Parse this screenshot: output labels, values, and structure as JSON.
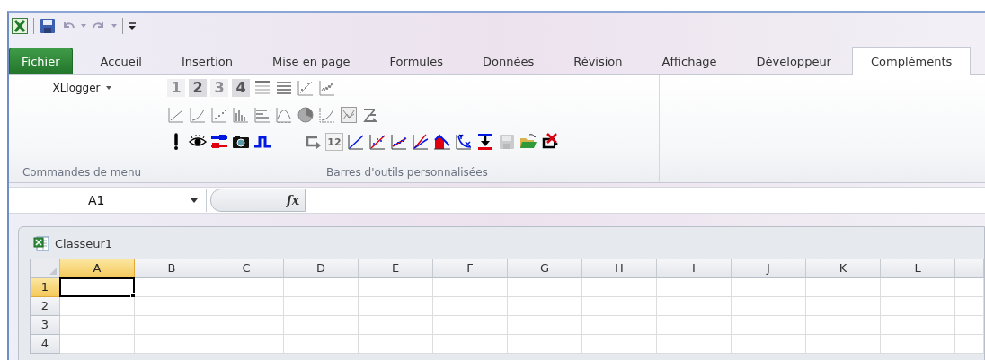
{
  "tabs": [
    {
      "label": "Fichier",
      "kind": "file",
      "selected": false
    },
    {
      "label": "Accueil",
      "kind": "tab",
      "selected": false
    },
    {
      "label": "Insertion",
      "kind": "tab",
      "selected": false
    },
    {
      "label": "Mise en page",
      "kind": "tab",
      "selected": false
    },
    {
      "label": "Formules",
      "kind": "tab",
      "selected": false
    },
    {
      "label": "Données",
      "kind": "tab",
      "selected": false
    },
    {
      "label": "Révision",
      "kind": "tab",
      "selected": false
    },
    {
      "label": "Affichage",
      "kind": "tab",
      "selected": false
    },
    {
      "label": "Développeur",
      "kind": "tab",
      "selected": false
    },
    {
      "label": "Compléments",
      "kind": "tab",
      "selected": true
    }
  ],
  "ribbon": {
    "menu_group": {
      "menu": "XLlogger",
      "label": "Commandes de menu"
    },
    "toolbar_group": {
      "label": "Barres d'outils personnalisées",
      "rows": [
        [
          {
            "kind": "number",
            "label": "1",
            "disabled": true
          },
          {
            "kind": "number",
            "label": "2",
            "disabled": false
          },
          {
            "kind": "number",
            "label": "3",
            "disabled": true
          },
          {
            "kind": "number",
            "label": "4",
            "disabled": false
          },
          {
            "kind": "thin-lines"
          },
          {
            "kind": "thick-lines"
          },
          {
            "kind": "scatter-trend"
          },
          {
            "kind": "noisy-line"
          }
        ],
        [
          {
            "kind": "rising-line"
          },
          {
            "kind": "curve"
          },
          {
            "kind": "dots"
          },
          {
            "kind": "bars"
          },
          {
            "kind": "hbars"
          },
          {
            "kind": "peak"
          },
          {
            "kind": "pie"
          },
          {
            "kind": "axis-curve"
          },
          {
            "kind": "chart-frame"
          },
          {
            "kind": "loop-arrow"
          }
        ],
        [
          {
            "kind": "exclamation"
          },
          {
            "kind": "eye"
          },
          {
            "kind": "toggle"
          },
          {
            "kind": "camera"
          },
          {
            "kind": "pulse"
          },
          {
            "kind": "spacer"
          },
          {
            "kind": "return-arrow"
          },
          {
            "kind": "number-box",
            "label": "12"
          },
          {
            "kind": "blue-line"
          },
          {
            "kind": "fit-dots"
          },
          {
            "kind": "noisy-fit"
          },
          {
            "kind": "two-curves"
          },
          {
            "kind": "area"
          },
          {
            "kind": "yx"
          },
          {
            "kind": "pin"
          },
          {
            "kind": "save",
            "disabled": true
          },
          {
            "kind": "folder"
          },
          {
            "kind": "delete-return"
          }
        ]
      ]
    }
  },
  "formula_bar": {
    "name_box": "A1",
    "fx": "fx"
  },
  "workbook": {
    "title": "Classeur1",
    "columns": [
      {
        "label": "A",
        "selected": true
      },
      {
        "label": "B",
        "selected": false
      },
      {
        "label": "C",
        "selected": false
      },
      {
        "label": "D",
        "selected": false
      },
      {
        "label": "E",
        "selected": false
      },
      {
        "label": "F",
        "selected": false
      },
      {
        "label": "G",
        "selected": false
      },
      {
        "label": "H",
        "selected": false
      },
      {
        "label": "I",
        "selected": false
      },
      {
        "label": "J",
        "selected": false
      },
      {
        "label": "K",
        "selected": false
      },
      {
        "label": "L",
        "selected": false
      }
    ],
    "rows": [
      {
        "label": "1",
        "selected": true
      },
      {
        "label": "2",
        "selected": false
      },
      {
        "label": "3",
        "selected": false
      },
      {
        "label": "4",
        "selected": false
      }
    ]
  }
}
